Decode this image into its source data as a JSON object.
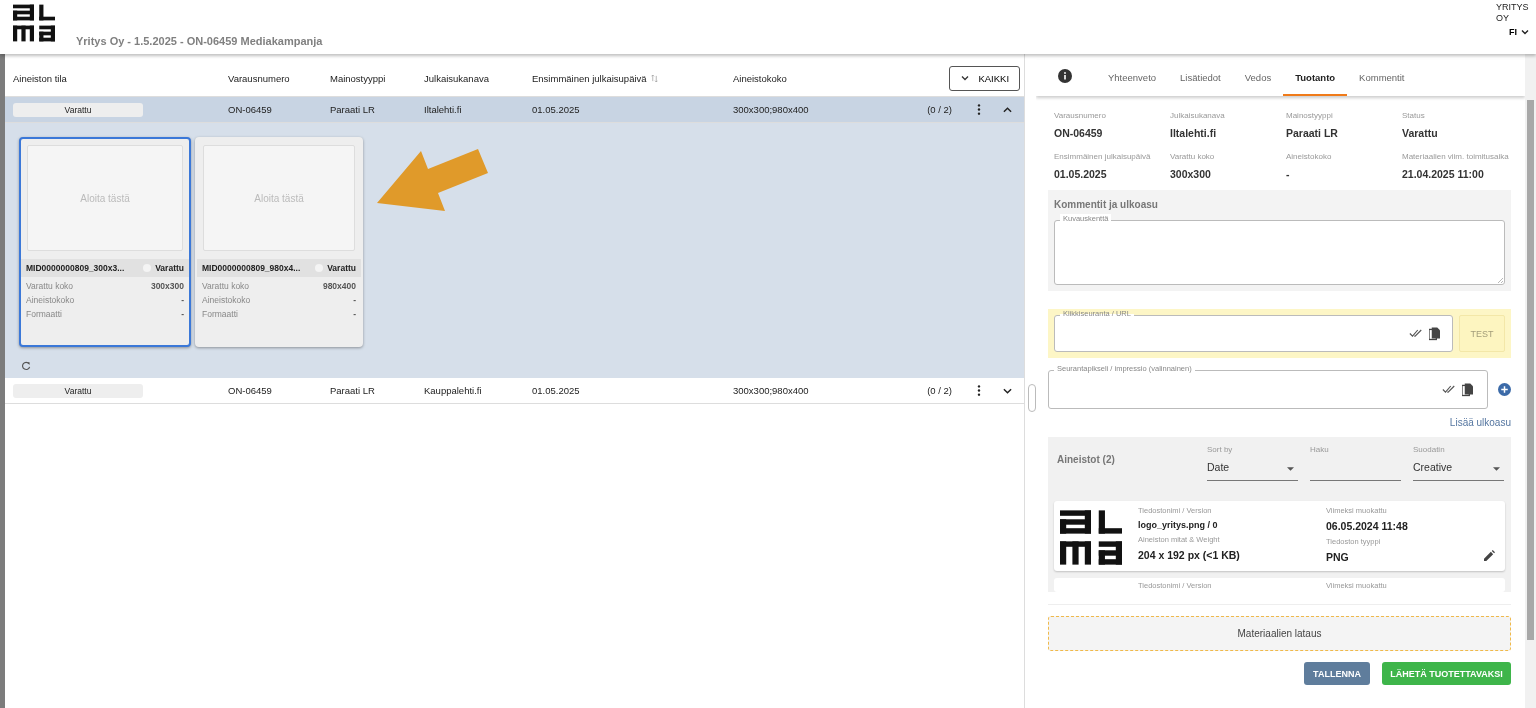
{
  "header": {
    "title": "Yritys Oy - 1.5.2025 - ON-06459 Mediakampanja",
    "account": "YRITYS OY",
    "language": "FI"
  },
  "table": {
    "columns": [
      {
        "label": "Aineiston tila",
        "sortable": false
      },
      {
        "label": "Varausnumero",
        "sortable": false
      },
      {
        "label": "Mainostyyppi",
        "sortable": false
      },
      {
        "label": "Julkaisukanava",
        "sortable": false
      },
      {
        "label": "Ensimmäinen julkaisupäivä",
        "sortable": true
      },
      {
        "label": "Aineistokoko",
        "sortable": false
      }
    ],
    "filter_button": "KAIKKI",
    "rows": [
      {
        "status": "Varattu",
        "number": "ON-06459",
        "type": "Paraati LR",
        "channel": "Iltalehti.fi",
        "date": "01.05.2025",
        "sizes": "300x300;980x400",
        "count": "(0 / 2)",
        "selected": true,
        "expanded": true,
        "cards": [
          {
            "name": "MID0000000809_300x3...",
            "status": "Varattu",
            "selected": true,
            "placeholder": "Aloita tästä",
            "fields": [
              {
                "label": "Varattu koko",
                "value": "300x300"
              },
              {
                "label": "Aineistokoko",
                "value": "-"
              },
              {
                "label": "Formaatti",
                "value": "-"
              }
            ]
          },
          {
            "name": "MID0000000809_980x4...",
            "status": "Varattu",
            "selected": false,
            "placeholder": "Aloita tästä",
            "fields": [
              {
                "label": "Varattu koko",
                "value": "980x400"
              },
              {
                "label": "Aineistokoko",
                "value": "-"
              },
              {
                "label": "Formaatti",
                "value": "-"
              }
            ]
          }
        ]
      },
      {
        "status": "Varattu",
        "number": "ON-06459",
        "type": "Paraati LR",
        "channel": "Kauppalehti.fi",
        "date": "01.05.2025",
        "sizes": "300x300;980x400",
        "count": "(0 / 2)",
        "selected": false,
        "expanded": false,
        "cards": []
      }
    ]
  },
  "panel": {
    "tabs": [
      {
        "kind": "icon",
        "selected": false
      },
      {
        "label": "Yhteenveto",
        "selected": false
      },
      {
        "label": "Lisätiedot",
        "selected": false
      },
      {
        "label": "Vedos",
        "selected": false
      },
      {
        "label": "Tuotanto",
        "selected": true
      },
      {
        "label": "Kommentit",
        "selected": false
      }
    ],
    "details": [
      {
        "label": "Varausnumero",
        "value": "ON-06459"
      },
      {
        "label": "Julkaisukanava",
        "value": "Iltalehti.fi"
      },
      {
        "label": "Mainostyyppi",
        "value": "Paraati LR"
      },
      {
        "label": "Status",
        "value": "Varattu"
      },
      {
        "label": "Ensimmäinen julkaisupäivä",
        "value": "01.05.2025"
      },
      {
        "label": "Varattu koko",
        "value": "300x300"
      },
      {
        "label": "Aineistokoko",
        "value": "-"
      },
      {
        "label": "Materiaalien viim. toimitusaika",
        "value": "21.04.2025 11:00"
      }
    ],
    "comments": {
      "title": "Kommentit ja ulkoasu",
      "description_label": "Kuvauskenttä"
    },
    "click_tracking": {
      "label": "Klikkiseuranta / URL",
      "test_button": "TEST",
      "test_disabled": true
    },
    "tracking_pixel": {
      "label": "Seurantapikseli / impressio (valinnainen)"
    },
    "add_layout": "Lisää ulkoasu",
    "assets": {
      "title": "Aineistot (2)",
      "sort": {
        "label": "Sort by",
        "value": "Date"
      },
      "search": {
        "label": "Haku"
      },
      "filter": {
        "label": "Suodatin",
        "value": "Creative"
      },
      "files": [
        {
          "name_label": "Tiedostonimi / Version",
          "name": "logo_yritys.png / 0",
          "modified_label": "Viimeksi muokattu",
          "modified": "06.05.2024 11:48",
          "size_label": "Aineiston mitat & Weight",
          "size": "204 x 192 px (<1 KB)",
          "type_label": "Tiedoston tyyppi",
          "type": "PNG"
        },
        {
          "name_label": "Tiedostonimi / Version",
          "modified_label": "Viimeksi muokattu"
        }
      ]
    },
    "upload": "Materiaalien lataus",
    "buttons": {
      "save": "TALLENNA",
      "send": "LÄHETÄ TUOTETTAVAKSI"
    }
  }
}
